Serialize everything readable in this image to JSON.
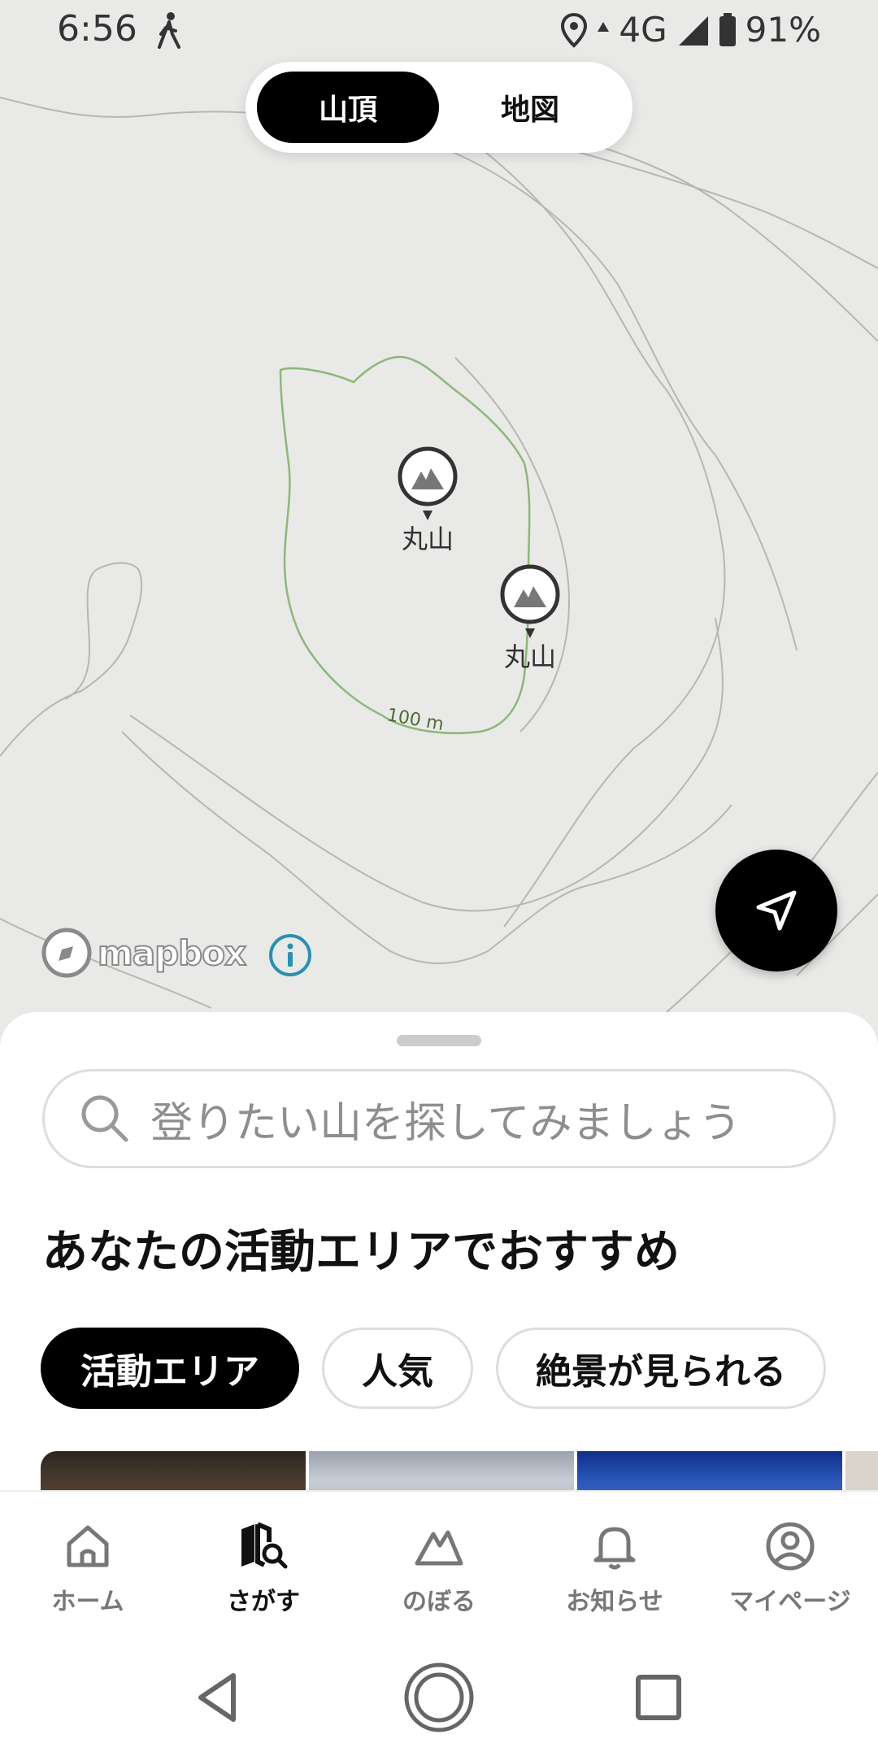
{
  "status_bar": {
    "time": "6:56",
    "network": "4G",
    "battery": "91%",
    "icons": [
      "walk-icon",
      "location-icon",
      "data-arrow-icon",
      "signal-icon",
      "battery-icon"
    ]
  },
  "segment": {
    "summit_label": "山頂",
    "map_label": "地図",
    "active": "山頂"
  },
  "map": {
    "contour_label": "100 m",
    "peaks": [
      {
        "name": "丸山",
        "icon": "mountain-pin-icon"
      },
      {
        "name": "丸山",
        "icon": "mountain-pin-icon"
      }
    ],
    "attribution": "mapbox",
    "colors": {
      "background": "#e9e9e7",
      "contour": "#8db77a",
      "minor_contour": "#b7b7b0"
    }
  },
  "sheet": {
    "search_placeholder": "登りたい山を探してみましょう",
    "section_title": "あなたの活動エリアでおすすめ",
    "chips": [
      "活動エリア",
      "人気",
      "絶景が見られる"
    ],
    "active_chip": "活動エリア"
  },
  "bottom_nav": {
    "items": [
      {
        "label": "ホーム",
        "icon": "home-icon"
      },
      {
        "label": "さがす",
        "icon": "map-search-icon"
      },
      {
        "label": "のぼる",
        "icon": "mountain-icon"
      },
      {
        "label": "お知らせ",
        "icon": "bell-icon"
      },
      {
        "label": "マイページ",
        "icon": "user-icon"
      }
    ],
    "active": "さがす"
  },
  "system_nav": {
    "icons": [
      "back-icon",
      "home-circle-icon",
      "recents-icon"
    ]
  }
}
